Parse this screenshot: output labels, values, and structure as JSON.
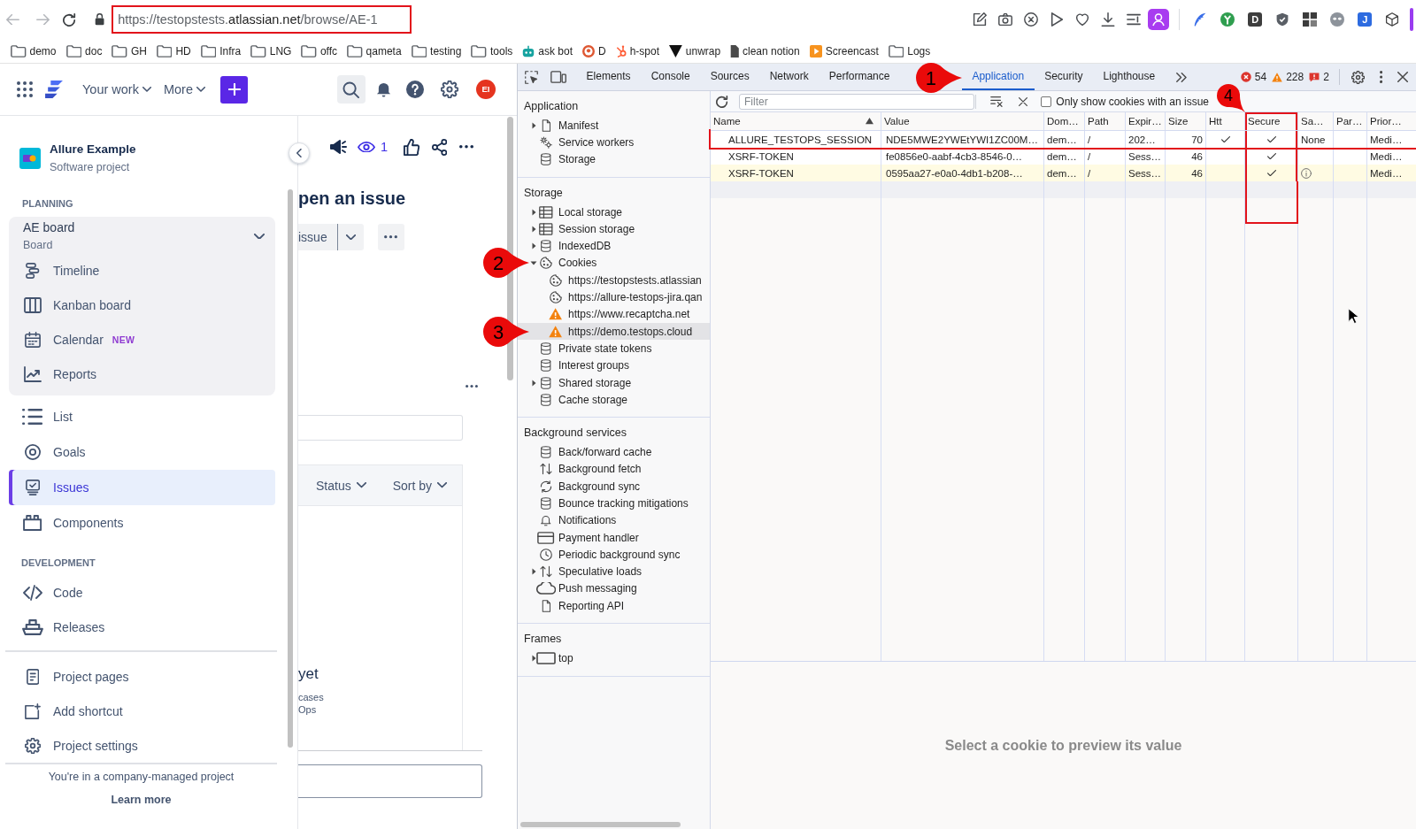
{
  "browser": {
    "address": "https://testopstests.**atlassian.net**/browse/AE-1",
    "address_highlighted": true,
    "extensions": [
      {
        "kind": "feather"
      },
      {
        "kind": "sprout"
      },
      {
        "kind": "letter",
        "label": "D",
        "color": "#3d3d3d"
      },
      {
        "kind": "shield"
      },
      {
        "kind": "blocks"
      },
      {
        "kind": "mask"
      },
      {
        "kind": "letter",
        "label": "J",
        "color": "#2d6be0"
      },
      {
        "kind": "cube"
      }
    ],
    "bookmarks": [
      {
        "label": "demo",
        "kind": "folder"
      },
      {
        "label": "doc",
        "kind": "folder"
      },
      {
        "label": "GH",
        "kind": "folder"
      },
      {
        "label": "HD",
        "kind": "folder"
      },
      {
        "label": "Infra",
        "kind": "folder"
      },
      {
        "label": "LNG",
        "kind": "folder"
      },
      {
        "label": "offc",
        "kind": "folder"
      },
      {
        "label": "qameta",
        "kind": "folder"
      },
      {
        "label": "testing",
        "kind": "folder"
      },
      {
        "label": "tools",
        "kind": "folder"
      },
      {
        "label": "ask bot",
        "kind": "robot"
      },
      {
        "label": "D",
        "kind": "duck"
      },
      {
        "label": "h-spot",
        "kind": "sprocket"
      },
      {
        "label": "unwrap",
        "kind": "triangle"
      },
      {
        "label": "clean notion",
        "kind": "page"
      },
      {
        "label": "Screencast",
        "kind": "player"
      },
      {
        "label": "Logs",
        "kind": "folder"
      }
    ]
  },
  "jira": {
    "nav": {
      "menus": [
        {
          "label": "Your work"
        },
        {
          "label": "More"
        }
      ],
      "avatar": "EI"
    },
    "project": {
      "name": "Allure Example",
      "type": "Software project"
    },
    "planning_heading": "PLANNING",
    "board": {
      "name": "AE board",
      "type": "Board",
      "expanded": true,
      "items": [
        {
          "label": "Timeline",
          "kind": "timeline",
          "selected": false
        },
        {
          "label": "Kanban board",
          "kind": "kanban",
          "selected": false
        },
        {
          "label": "Calendar",
          "kind": "calendar",
          "badge": "NEW",
          "selected": false
        },
        {
          "label": "Reports",
          "kind": "reports",
          "selected": false
        }
      ]
    },
    "planning_items": [
      {
        "label": "List",
        "kind": "list",
        "selected": false
      },
      {
        "label": "Goals",
        "kind": "goals",
        "selected": false
      },
      {
        "label": "Issues",
        "kind": "issues",
        "selected": true
      },
      {
        "label": "Components",
        "kind": "components",
        "selected": false
      }
    ],
    "development_heading": "DEVELOPMENT",
    "development_items": [
      {
        "label": "Code",
        "kind": "code",
        "selected": false
      },
      {
        "label": "Releases",
        "kind": "releases",
        "selected": false
      }
    ],
    "project_items": [
      {
        "label": "Project pages",
        "kind": "pages",
        "selected": false
      },
      {
        "label": "Add shortcut",
        "kind": "shortcut",
        "selected": false
      },
      {
        "label": "Project settings",
        "kind": "settings",
        "selected": false
      }
    ],
    "footer": {
      "note": "You're in a company-managed project",
      "link": "Learn more"
    }
  },
  "issue_view": {
    "watchers": "1",
    "title": "pen an issue",
    "action": "issue",
    "filters": [
      {
        "label": "Status"
      },
      {
        "label": "Sort by"
      }
    ],
    "empty_title": "yet",
    "empty_lines": [
      "cases",
      "Ops"
    ]
  },
  "devtools": {
    "tabs": [
      {
        "label": "Elements",
        "selected": false
      },
      {
        "label": "Console",
        "selected": false
      },
      {
        "label": "Sources",
        "selected": false
      },
      {
        "label": "Network",
        "selected": false
      },
      {
        "label": "Performance",
        "selected": false
      },
      {
        "label": "Application",
        "selected": true,
        "callout": "1"
      },
      {
        "label": "Security",
        "selected": false
      },
      {
        "label": "Lighthouse",
        "selected": false
      }
    ],
    "counts": [
      {
        "kind": "error",
        "value": "54"
      },
      {
        "kind": "warning",
        "value": "228"
      },
      {
        "kind": "issue",
        "value": "2"
      }
    ],
    "sidebar": [
      {
        "title": "Application",
        "items": [
          {
            "label": "Manifest",
            "kind": "file",
            "expanded": false,
            "selected": false
          },
          {
            "label": "Service workers",
            "kind": "gears",
            "selected": false
          },
          {
            "label": "Storage",
            "kind": "database",
            "selected": false
          }
        ]
      },
      {
        "title": "Storage",
        "items": [
          {
            "label": "Local storage",
            "kind": "table",
            "expanded": false,
            "selected": false
          },
          {
            "label": "Session storage",
            "kind": "table",
            "expanded": false,
            "selected": false
          },
          {
            "label": "IndexedDB",
            "kind": "database",
            "expanded": false,
            "selected": false
          },
          {
            "label": "Cookies",
            "kind": "cookie",
            "expanded": true,
            "selected": false,
            "callout": "2",
            "children": [
              {
                "label": "https://testopstests.atlassian",
                "kind": "cookie",
                "selected": false
              },
              {
                "label": "https://allure-testops-jira.qan",
                "kind": "cookie",
                "selected": false
              },
              {
                "label": "https://www.recaptcha.net",
                "kind": "warning",
                "selected": false
              },
              {
                "label": "https://demo.testops.cloud",
                "kind": "warning",
                "selected": true,
                "callout": "3"
              }
            ]
          },
          {
            "label": "Private state tokens",
            "kind": "database",
            "selected": false
          },
          {
            "label": "Interest groups",
            "kind": "database",
            "selected": false
          },
          {
            "label": "Shared storage",
            "kind": "database",
            "expanded": false,
            "selected": false
          },
          {
            "label": "Cache storage",
            "kind": "database",
            "selected": false
          }
        ]
      },
      {
        "title": "Background services",
        "items": [
          {
            "label": "Back/forward cache",
            "kind": "database",
            "selected": false
          },
          {
            "label": "Background fetch",
            "kind": "transfer",
            "selected": false
          },
          {
            "label": "Background sync",
            "kind": "sync",
            "selected": false
          },
          {
            "label": "Bounce tracking mitigations",
            "kind": "database",
            "selected": false
          },
          {
            "label": "Notifications",
            "kind": "bell",
            "selected": false
          },
          {
            "label": "Payment handler",
            "kind": "card",
            "selected": false
          },
          {
            "label": "Periodic background sync",
            "kind": "clock",
            "selected": false
          },
          {
            "label": "Speculative loads",
            "kind": "transfer",
            "expanded": false,
            "selected": false
          },
          {
            "label": "Push messaging",
            "kind": "cloud",
            "selected": false
          },
          {
            "label": "Reporting API",
            "kind": "file",
            "selected": false
          }
        ]
      },
      {
        "title": "Frames",
        "items": [
          {
            "label": "top",
            "kind": "frame",
            "expanded": false,
            "selected": false
          }
        ]
      }
    ],
    "cookies": {
      "filter_placeholder": "Filter",
      "issue_filter": {
        "label": "Only show cookies with an issue",
        "checked": false
      },
      "columns": [
        {
          "label": "Name",
          "sorted": true,
          "highlighted": false
        },
        {
          "label": "Value",
          "highlighted": false
        },
        {
          "label": "Dom…",
          "highlighted": false
        },
        {
          "label": "Path",
          "highlighted": false
        },
        {
          "label": "Expir…",
          "highlighted": false
        },
        {
          "label": "Size",
          "highlighted": false
        },
        {
          "label": "Htt",
          "highlighted": false
        },
        {
          "label": "Secure",
          "highlighted": true,
          "callout": "4"
        },
        {
          "label": "Sa…",
          "highlighted": false
        },
        {
          "label": "Par…",
          "highlighted": false
        },
        {
          "label": "Prior…",
          "highlighted": false
        }
      ],
      "rows": [
        {
          "highlighted": true,
          "warning": false,
          "cells": [
            {
              "kind": "text",
              "text": "ALLURE_TESTOPS_SESSION"
            },
            {
              "kind": "text",
              "text": "NDE5MWE2YWEtYWI1ZC00M…"
            },
            {
              "kind": "text",
              "text": "dem…"
            },
            {
              "kind": "text",
              "text": "/"
            },
            {
              "kind": "text",
              "text": "202…"
            },
            {
              "kind": "text",
              "text": "70"
            },
            {
              "kind": "check",
              "checked": true
            },
            {
              "kind": "check",
              "checked": true
            },
            {
              "kind": "text",
              "text": "None"
            },
            {
              "kind": "empty"
            },
            {
              "kind": "text",
              "text": "Medi…"
            }
          ]
        },
        {
          "highlighted": false,
          "warning": false,
          "cells": [
            {
              "kind": "text",
              "text": "XSRF-TOKEN"
            },
            {
              "kind": "text",
              "text": "fe0856e0-aabf-4cb3-8546-0…"
            },
            {
              "kind": "text",
              "text": "dem…"
            },
            {
              "kind": "text",
              "text": "/"
            },
            {
              "kind": "text",
              "text": "Sess…"
            },
            {
              "kind": "text",
              "text": "46"
            },
            {
              "kind": "check",
              "checked": false
            },
            {
              "kind": "check",
              "checked": true
            },
            {
              "kind": "empty"
            },
            {
              "kind": "empty"
            },
            {
              "kind": "text",
              "text": "Medi…"
            }
          ]
        },
        {
          "highlighted": false,
          "warning": true,
          "cells": [
            {
              "kind": "text",
              "text": "XSRF-TOKEN"
            },
            {
              "kind": "text",
              "text": "0595aa27-e0a0-4db1-b208-…"
            },
            {
              "kind": "text",
              "text": "dem…"
            },
            {
              "kind": "text",
              "text": "/"
            },
            {
              "kind": "text",
              "text": "Sess…"
            },
            {
              "kind": "text",
              "text": "46"
            },
            {
              "kind": "check",
              "checked": false
            },
            {
              "kind": "check",
              "checked": true
            },
            {
              "kind": "info"
            },
            {
              "kind": "empty"
            },
            {
              "kind": "text",
              "text": "Medi…"
            }
          ]
        }
      ]
    },
    "preview_hint": "Select a cookie to preview its value"
  }
}
